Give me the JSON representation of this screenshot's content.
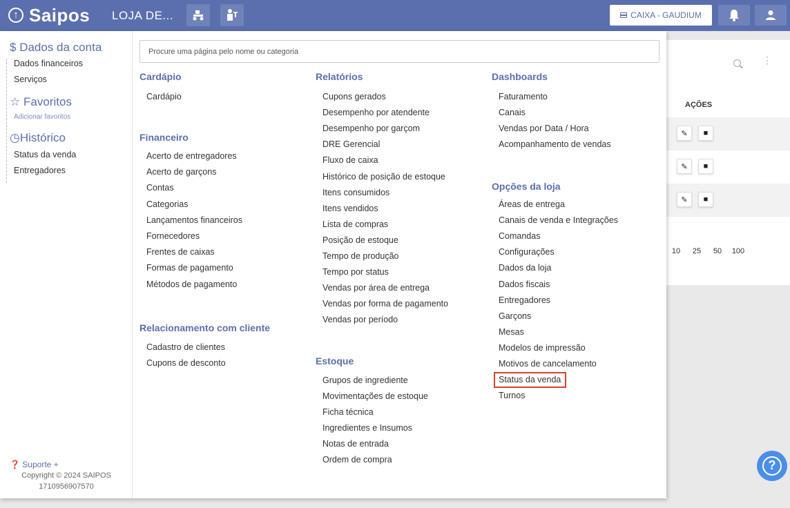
{
  "topbar": {
    "brand": "Saipos",
    "store": "LOJA DE...",
    "caixa": "CAIXA - GAUDIUM"
  },
  "search": {
    "placeholder": "Procure uma página pelo nome ou categoria"
  },
  "sidebar": {
    "account": {
      "title": "Dados da conta",
      "items": [
        "Dados financeiros",
        "Serviços"
      ]
    },
    "favorites": {
      "title": "Favoritos",
      "add": "Adicionar favoritos"
    },
    "history": {
      "title": "Histórico",
      "items": [
        "Status da venda",
        "Entregadores"
      ]
    },
    "support": "Suporte +",
    "copyright": "Copyright © 2024 SAIPOS",
    "build": "1710956907570"
  },
  "columns": {
    "cardapio": {
      "title": "Cardápio",
      "items": [
        "Cardápio"
      ]
    },
    "financeiro": {
      "title": "Financeiro",
      "items": [
        "Acerto de entregadores",
        "Acerto de garçons",
        "Contas",
        "Categorias",
        "Lançamentos financeiros",
        "Fornecedores",
        "Frentes de caixas",
        "Formas de pagamento",
        "Métodos de pagamento"
      ]
    },
    "relacionamento": {
      "title": "Relacionamento com cliente",
      "items": [
        "Cadastro de clientes",
        "Cupons de desconto"
      ]
    },
    "relatorios": {
      "title": "Relatórios",
      "items": [
        "Cupons gerados",
        "Desempenho por atendente",
        "Desempenho por garçom",
        "DRE Gerencial",
        "Fluxo de caixa",
        "Histórico de posição de estoque",
        "Itens consumidos",
        "Itens vendidos",
        "Lista de compras",
        "Posição de estoque",
        "Tempo de produção",
        "Tempo por status",
        "Vendas por área de entrega",
        "Vendas por forma de pagamento",
        "Vendas por período"
      ]
    },
    "estoque": {
      "title": "Estoque",
      "items": [
        "Grupos de ingrediente",
        "Movimentações de estoque",
        "Ficha técnica",
        "Ingredientes e Insumos",
        "Notas de entrada",
        "Ordem de compra"
      ]
    },
    "dashboards": {
      "title": "Dashboards",
      "items": [
        "Faturamento",
        "Canais",
        "Vendas por Data / Hora",
        "Acompanhamento de vendas"
      ]
    },
    "opcoes": {
      "title": "Opções da loja",
      "items": [
        "Áreas de entrega",
        "Canais de venda e Integrações",
        "Comandas",
        "Configurações",
        "Dados da loja",
        "Dados fiscais",
        "Entregadores",
        "Garçons",
        "Mesas",
        "Modelos de impressão",
        "Motivos de cancelamento",
        "Status da venda",
        "Turnos"
      ]
    }
  },
  "background": {
    "acoes": "AÇÕES",
    "pager": [
      "10",
      "25",
      "50",
      "100"
    ]
  },
  "colors": {
    "primary": "#5b6fae",
    "highlight": "#d9412b",
    "help": "#4a8ee8"
  }
}
